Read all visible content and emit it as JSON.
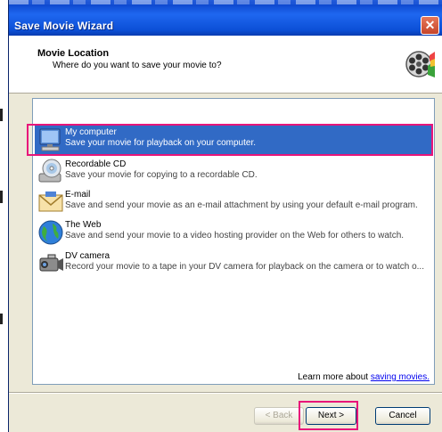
{
  "window": {
    "title": "Save Movie Wizard",
    "close_glyph": "✕"
  },
  "header": {
    "title": "Movie Location",
    "subtitle": "Where do you want to save your movie to?",
    "icon": "film-reel-icon"
  },
  "options": [
    {
      "label": "My computer",
      "description": "Save your movie for playback on your computer.",
      "icon": "computer-icon",
      "selected": true
    },
    {
      "label": "Recordable CD",
      "description": "Save your movie for copying to a recordable CD.",
      "icon": "cd-icon",
      "selected": false
    },
    {
      "label": "E-mail",
      "description": "Save and send your movie as an e-mail attachment by using your default e-mail program.",
      "icon": "email-icon",
      "selected": false
    },
    {
      "label": "The Web",
      "description": "Save and send your movie to a video hosting provider on the Web for others to watch.",
      "icon": "globe-icon",
      "selected": false
    },
    {
      "label": "DV camera",
      "description": "Record your movie to a tape in your DV camera for playback on the camera or to watch o...",
      "icon": "camcorder-icon",
      "selected": false
    }
  ],
  "footer": {
    "learn_text": "Learn more about",
    "learn_link": "saving movies."
  },
  "buttons": {
    "back": "< Back",
    "next": "Next >",
    "cancel": "Cancel"
  },
  "colors": {
    "titlebar": "#0b4fd6",
    "selection": "#316ac5",
    "highlight": "#e8157a",
    "close": "#c6452a"
  }
}
